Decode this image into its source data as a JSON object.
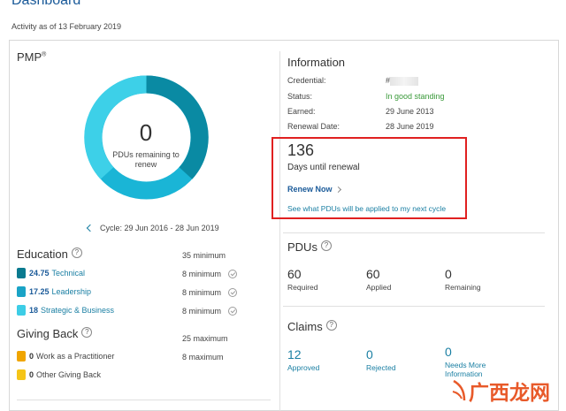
{
  "header": {
    "title": "Dashboard",
    "activity": "Activity as of 13 February 2019"
  },
  "pmp": {
    "title": "PMP",
    "sup": "®",
    "remaining_number": "0",
    "remaining_text": "PDUs remaining to renew",
    "cycle": "Cycle: 29 Jun 2016 - 28 Jun 2019",
    "donut_colors": [
      "#0a8aa3",
      "#1ab5d6",
      "#3dd0e8"
    ]
  },
  "education": {
    "title": "Education",
    "requirement": "35 minimum",
    "items": [
      {
        "value": "24.75",
        "label": "Technical",
        "requirement": "8 minimum",
        "color": "#0a7a8f"
      },
      {
        "value": "17.25",
        "label": "Leadership",
        "requirement": "8 minimum",
        "color": "#1aa3c6"
      },
      {
        "value": "18",
        "label": "Strategic & Business",
        "requirement": "8 minimum",
        "color": "#3dcde6"
      }
    ]
  },
  "giving_back": {
    "title": "Giving Back",
    "requirement": "25 maximum",
    "items": [
      {
        "value": "0",
        "label": "Work as a Practitioner",
        "requirement": "8 maximum",
        "color": "#f0a500"
      },
      {
        "value": "0",
        "label": "Other Giving Back",
        "requirement": "",
        "color": "#f5c518"
      }
    ]
  },
  "information": {
    "title": "Information",
    "credential_label": "Credential:",
    "credential_value": "#",
    "status_label": "Status:",
    "status_value": "In good standing",
    "earned_label": "Earned:",
    "earned_value": "29 June 2013",
    "renewal_label": "Renewal Date:",
    "renewal_value": "28 June 2019"
  },
  "renewal": {
    "days": "136",
    "days_text": "Days until renewal",
    "renew_now": "Renew Now",
    "see_link": "See what PDUs will be applied to my next cycle"
  },
  "pdus": {
    "title": "PDUs",
    "stats": [
      {
        "value": "60",
        "label": "Required"
      },
      {
        "value": "60",
        "label": "Applied"
      },
      {
        "value": "0",
        "label": "Remaining"
      }
    ]
  },
  "claims": {
    "title": "Claims",
    "stats": [
      {
        "value": "12",
        "label": "Approved"
      },
      {
        "value": "0",
        "label": "Rejected"
      },
      {
        "value": "0",
        "label": "Needs More Information"
      }
    ]
  },
  "watermark": {
    "text": "广西龙网"
  }
}
